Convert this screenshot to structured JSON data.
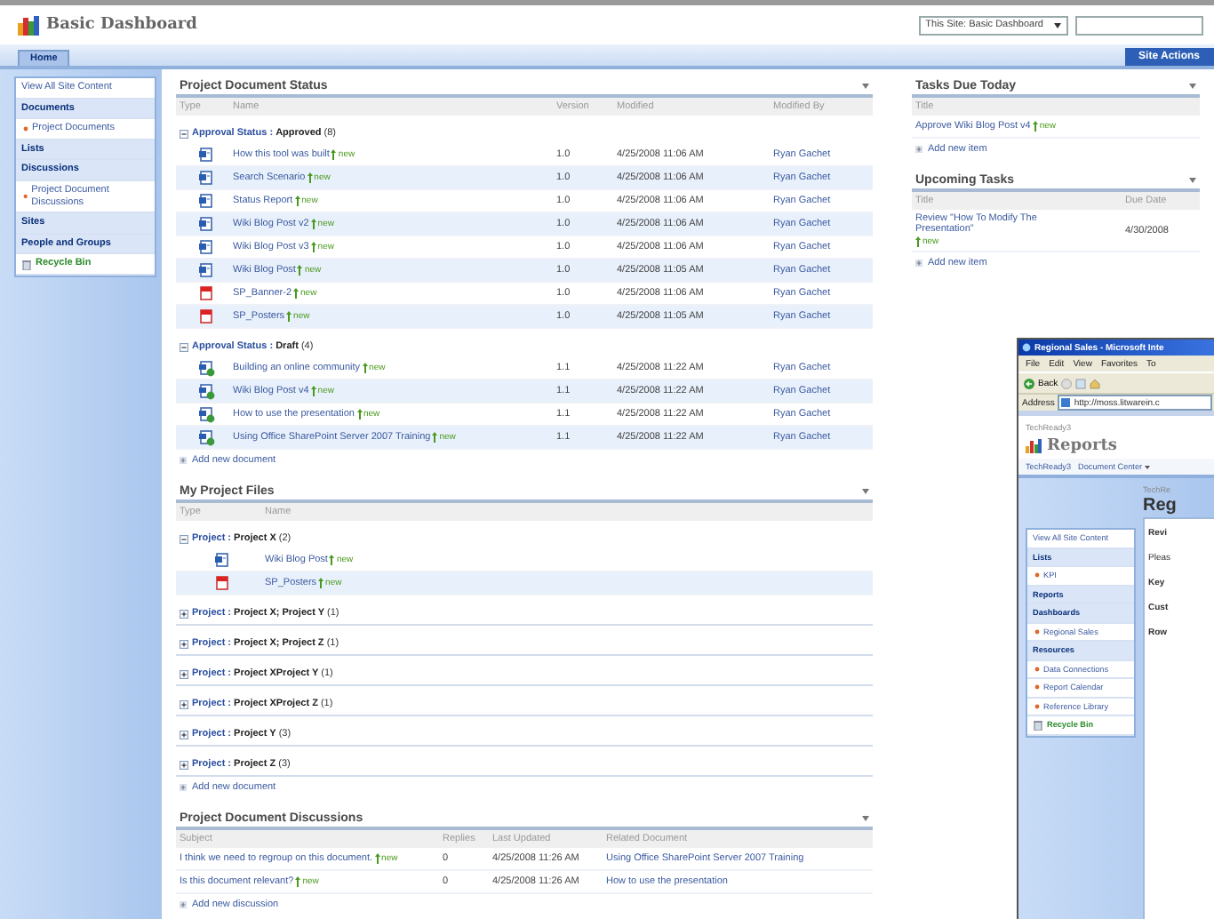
{
  "header": {
    "title": "Basic Dashboard",
    "scope": "This Site: Basic Dashboard",
    "site_actions": "Site Actions"
  },
  "tabs": [
    {
      "label": "Home",
      "selected": true
    }
  ],
  "sidebar": {
    "items": [
      {
        "label": "View All Site Content",
        "kind": "link"
      },
      {
        "label": "Documents",
        "kind": "heading"
      },
      {
        "label": "Project Documents",
        "kind": "bullet"
      },
      {
        "label": "Lists",
        "kind": "heading"
      },
      {
        "label": "Discussions",
        "kind": "heading"
      },
      {
        "label": "Project Document Discussions",
        "kind": "bullet"
      },
      {
        "label": "Sites",
        "kind": "heading"
      },
      {
        "label": "People and Groups",
        "kind": "heading"
      },
      {
        "label": "Recycle Bin",
        "kind": "recycle"
      }
    ]
  },
  "doc_status": {
    "title": "Project Document Status",
    "columns": [
      "Type",
      "Name",
      "Version",
      "Modified",
      "Modified By"
    ],
    "groups": [
      {
        "field": "Approval Status :",
        "value": "Approved",
        "count": "(8)",
        "expanded": true,
        "rows": [
          {
            "kind": "doc",
            "name": "How this tool was built",
            "badge": "new",
            "version": "1.0",
            "modified": "4/25/2008 11:06 AM",
            "modified_by": "Ryan Gachet"
          },
          {
            "kind": "doc",
            "name": "Search Scenario",
            "badge": "new",
            "version": "1.0",
            "modified": "4/25/2008 11:06 AM",
            "modified_by": "Ryan Gachet"
          },
          {
            "kind": "doc",
            "name": "Status Report",
            "badge": "new",
            "version": "1.0",
            "modified": "4/25/2008 11:06 AM",
            "modified_by": "Ryan Gachet"
          },
          {
            "kind": "doc",
            "name": "Wiki Blog Post v2",
            "badge": "new",
            "version": "1.0",
            "modified": "4/25/2008 11:06 AM",
            "modified_by": "Ryan Gachet"
          },
          {
            "kind": "doc",
            "name": "Wiki Blog Post v3",
            "badge": "new",
            "version": "1.0",
            "modified": "4/25/2008 11:06 AM",
            "modified_by": "Ryan Gachet"
          },
          {
            "kind": "doc",
            "name": "Wiki Blog Post",
            "badge": "new",
            "version": "1.0",
            "modified": "4/25/2008 11:05 AM",
            "modified_by": "Ryan Gachet"
          },
          {
            "kind": "pdf",
            "name": "SP_Banner-2",
            "badge": "new",
            "version": "1.0",
            "modified": "4/25/2008 11:06 AM",
            "modified_by": "Ryan Gachet"
          },
          {
            "kind": "pdf",
            "name": "SP_Posters",
            "badge": "new",
            "version": "1.0",
            "modified": "4/25/2008 11:05 AM",
            "modified_by": "Ryan Gachet"
          }
        ]
      },
      {
        "field": "Approval Status :",
        "value": "Draft",
        "count": "(4)",
        "expanded": true,
        "rows": [
          {
            "kind": "draft",
            "name": "Building an online community",
            "badge": "new",
            "version": "1.1",
            "modified": "4/25/2008 11:22 AM",
            "modified_by": "Ryan Gachet"
          },
          {
            "kind": "draft",
            "name": "Wiki Blog Post v4",
            "badge": "new",
            "version": "1.1",
            "modified": "4/25/2008 11:22 AM",
            "modified_by": "Ryan Gachet"
          },
          {
            "kind": "draft",
            "name": "How to use the presentation",
            "badge": "new",
            "version": "1.1",
            "modified": "4/25/2008 11:22 AM",
            "modified_by": "Ryan Gachet"
          },
          {
            "kind": "draft",
            "name": "Using Office SharePoint Server 2007 Training",
            "badge": "new",
            "version": "1.1",
            "modified": "4/25/2008 11:22 AM",
            "modified_by": "Ryan Gachet"
          }
        ]
      }
    ],
    "add": "Add new document"
  },
  "project_files": {
    "title": "My Project Files",
    "columns": [
      "Type",
      "Name"
    ],
    "groups": [
      {
        "field": "Project :",
        "value": "Project X",
        "count": "(2)",
        "expanded": true,
        "rows": [
          {
            "kind": "doc",
            "name": "Wiki Blog Post",
            "badge": "new"
          },
          {
            "kind": "pdf",
            "name": "SP_Posters",
            "badge": "new"
          }
        ]
      },
      {
        "field": "Project :",
        "value": "Project X; Project Y",
        "count": "(1)",
        "expanded": false
      },
      {
        "field": "Project :",
        "value": "Project X; Project Z",
        "count": "(1)",
        "expanded": false
      },
      {
        "field": "Project :",
        "value": "Project XProject Y",
        "count": "(1)",
        "expanded": false
      },
      {
        "field": "Project :",
        "value": "Project XProject Z",
        "count": "(1)",
        "expanded": false
      },
      {
        "field": "Project :",
        "value": "Project Y",
        "count": "(3)",
        "expanded": false
      },
      {
        "field": "Project :",
        "value": "Project Z",
        "count": "(3)",
        "expanded": false
      }
    ],
    "add": "Add new document"
  },
  "discussions": {
    "title": "Project Document Discussions",
    "columns": [
      "Subject",
      "Replies",
      "Last Updated",
      "Related Document"
    ],
    "rows": [
      {
        "subject": "I think we need to regroup on this document.",
        "badge": "new",
        "replies": "0",
        "last_updated": "4/25/2008 11:26 AM",
        "related": "Using Office SharePoint Server 2007 Training"
      },
      {
        "subject": "Is this document relevant?",
        "badge": "new",
        "replies": "0",
        "last_updated": "4/25/2008 11:26 AM",
        "related": "How to use the presentation"
      }
    ],
    "add": "Add new discussion"
  },
  "tasks_today": {
    "title": "Tasks Due Today",
    "columns": [
      "Title"
    ],
    "rows": [
      {
        "title": "Approve Wiki Blog Post v4",
        "badge": "new"
      }
    ],
    "add": "Add new item"
  },
  "upcoming_tasks": {
    "title": "Upcoming Tasks",
    "columns": [
      "Title",
      "Due Date"
    ],
    "rows": [
      {
        "title": "Review \"How To Modify The Presentation\"",
        "badge": "new",
        "due": "4/30/2008"
      }
    ],
    "add": "Add new item"
  },
  "browser_window": {
    "title": "Regional Sales - Microsoft Inte",
    "menu": [
      "File",
      "Edit",
      "View",
      "Favorites",
      "To"
    ],
    "back": "Back",
    "address_label": "Address",
    "url": "http://moss.litwarein.c",
    "site": "TechReady3",
    "app_title": "Reports",
    "breadcrumb": [
      "TechReady3",
      "Document Center"
    ],
    "crumb": "TechRe",
    "page_title": "Reg",
    "sidebar": [
      {
        "label": "View All Site Content",
        "kind": "link"
      },
      {
        "label": "Lists",
        "kind": "heading"
      },
      {
        "label": "KPI",
        "kind": "bullet"
      },
      {
        "label": "Reports",
        "kind": "heading"
      },
      {
        "label": "Dashboards",
        "kind": "heading"
      },
      {
        "label": "Regional Sales",
        "kind": "bullet"
      },
      {
        "label": "Resources",
        "kind": "heading"
      },
      {
        "label": "Data Connections",
        "kind": "bullet"
      },
      {
        "label": "Report Calendar",
        "kind": "bullet"
      },
      {
        "label": "Reference Library",
        "kind": "bullet"
      },
      {
        "label": "Recycle Bin",
        "kind": "recycle"
      }
    ],
    "content": [
      "Revi",
      "Pleas",
      "Key",
      "Cust",
      "Row"
    ]
  }
}
